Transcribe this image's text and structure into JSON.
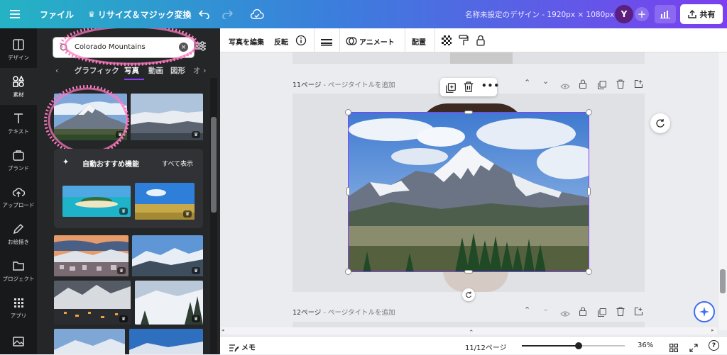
{
  "topbar": {
    "file_label": "ファイル",
    "resize_label": "リサイズ＆マジック変換",
    "doc_title": "名称未設定のデザイン - 1920px × 1080px",
    "avatar_letter": "Y",
    "share_label": "共有"
  },
  "rail": {
    "items": [
      {
        "label": "デザイン"
      },
      {
        "label": "素材"
      },
      {
        "label": "テキスト"
      },
      {
        "label": "ブランド"
      },
      {
        "label": "アップロード"
      },
      {
        "label": "お絵描き"
      },
      {
        "label": "プロジェクト"
      },
      {
        "label": "アプリ"
      }
    ]
  },
  "panel": {
    "search_value": "Colorado Mountains",
    "tabs": [
      {
        "label": "グラフィック"
      },
      {
        "label": "写真"
      },
      {
        "label": "動画"
      },
      {
        "label": "図形"
      },
      {
        "label": "オ"
      }
    ],
    "suggestions_title": "自動おすすめ機能",
    "see_all": "すべて表示"
  },
  "context_toolbar": {
    "edit_photo": "写真を編集",
    "flip": "反転",
    "animate": "アニメート",
    "position": "配置"
  },
  "canvas": {
    "page11_label": "11ページ",
    "page11_sub": "- ページタイトルを追加",
    "page12_label": "12ページ",
    "page12_sub": "- ページタイトルを追加"
  },
  "bottombar": {
    "notes_label": "メモ",
    "page_count": "11/12ページ",
    "zoom": "36%",
    "zoom_fraction": 0.55
  },
  "colors": {
    "accent": "#8b3dff",
    "topbar_start": "#24b3c4",
    "topbar_end": "#7b3ff0",
    "rail_bg": "#18191b",
    "panel_bg": "#252627",
    "annotation": "#ff7ac2"
  }
}
